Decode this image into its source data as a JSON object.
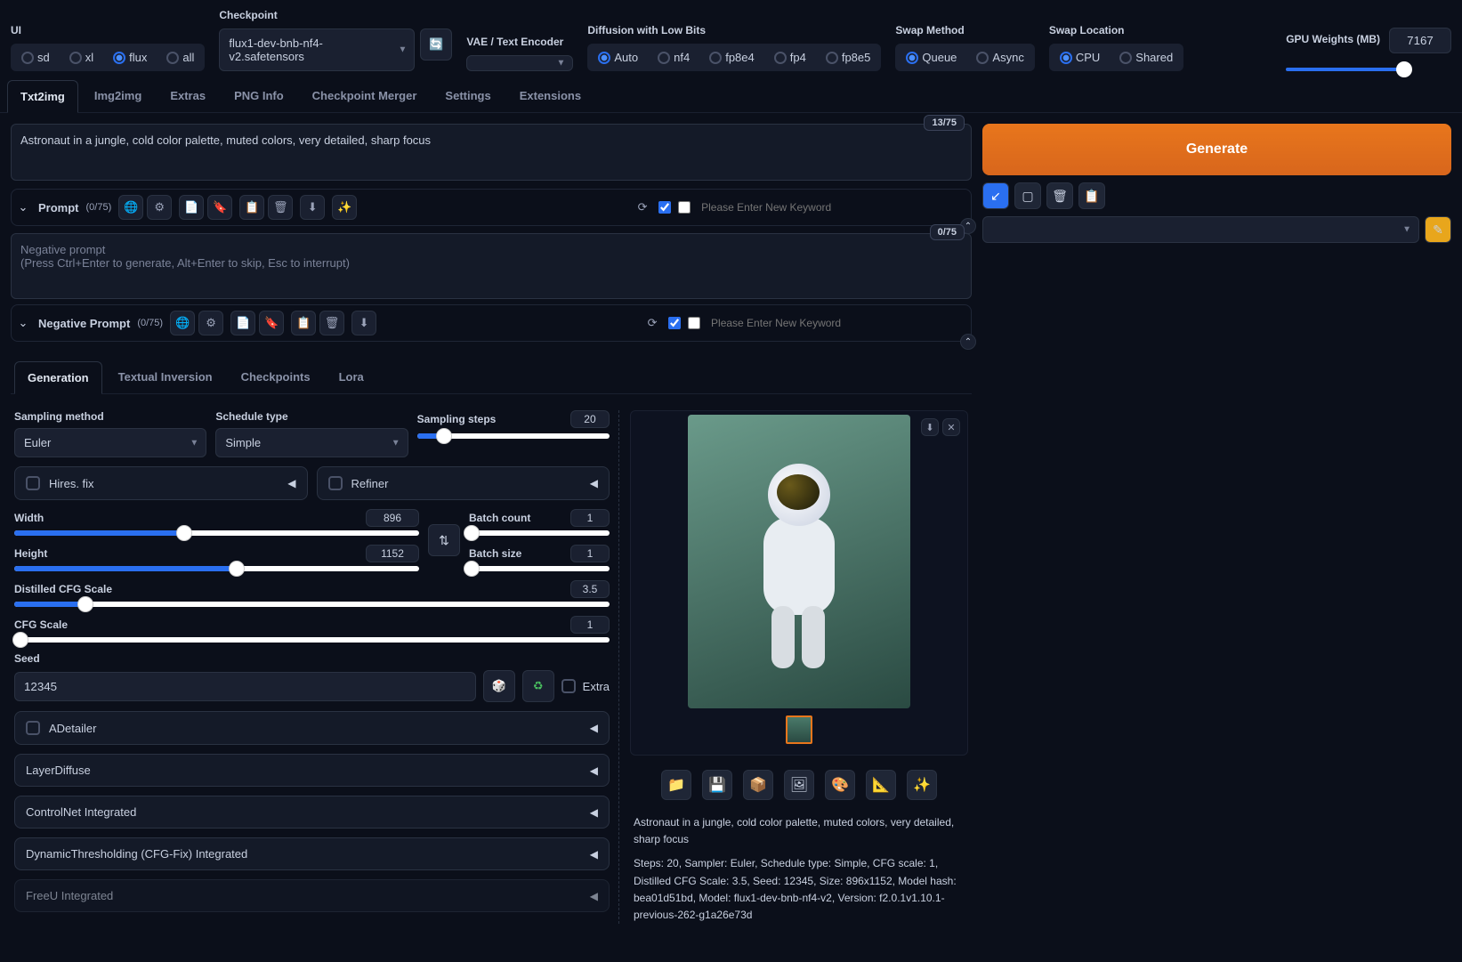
{
  "top": {
    "ui_label": "UI",
    "ui_options": [
      "sd",
      "xl",
      "flux",
      "all"
    ],
    "ui_selected": "flux",
    "checkpoint_label": "Checkpoint",
    "checkpoint_value": "flux1-dev-bnb-nf4-v2.safetensors",
    "vae_label": "VAE / Text Encoder",
    "vae_value": "",
    "diffusion_label": "Diffusion with Low Bits",
    "diffusion_options": [
      "Auto",
      "nf4",
      "fp8e4",
      "fp4",
      "fp8e5"
    ],
    "diffusion_selected": "Auto",
    "swap_method_label": "Swap Method",
    "swap_method_options": [
      "Queue",
      "Async"
    ],
    "swap_method_selected": "Queue",
    "swap_location_label": "Swap Location",
    "swap_location_options": [
      "CPU",
      "Shared"
    ],
    "swap_location_selected": "CPU",
    "gpu_label": "GPU Weights (MB)",
    "gpu_value": "7167"
  },
  "tabs": [
    "Txt2img",
    "Img2img",
    "Extras",
    "PNG Info",
    "Checkpoint Merger",
    "Settings",
    "Extensions"
  ],
  "active_tab": "Txt2img",
  "prompt": {
    "value": "Astronaut in a jungle, cold color palette, muted colors, very detailed, sharp focus",
    "tokens": "13/75",
    "label": "Prompt",
    "sub": "(0/75)",
    "keyword_placeholder": "Please Enter New Keyword"
  },
  "neg": {
    "placeholder_title": "Negative prompt",
    "placeholder_help": "(Press Ctrl+Enter to generate, Alt+Enter to skip, Esc to interrupt)",
    "tokens": "0/75",
    "label": "Negative Prompt",
    "sub": "(0/75)",
    "keyword_placeholder": "Please Enter New Keyword"
  },
  "generate": "Generate",
  "subtabs": [
    "Generation",
    "Textual Inversion",
    "Checkpoints",
    "Lora"
  ],
  "active_subtab": "Generation",
  "gen": {
    "sampling_method_label": "Sampling method",
    "sampling_method": "Euler",
    "schedule_label": "Schedule type",
    "schedule": "Simple",
    "steps_label": "Sampling steps",
    "steps": "20",
    "hires_label": "Hires. fix",
    "refiner_label": "Refiner",
    "width_label": "Width",
    "width": "896",
    "height_label": "Height",
    "height": "1152",
    "batch_count_label": "Batch count",
    "batch_count": "1",
    "batch_size_label": "Batch size",
    "batch_size": "1",
    "dcfg_label": "Distilled CFG Scale",
    "dcfg": "3.5",
    "cfg_label": "CFG Scale",
    "cfg": "1",
    "seed_label": "Seed",
    "seed": "12345",
    "extra_label": "Extra",
    "accordions": [
      "ADetailer",
      "LayerDiffuse",
      "ControlNet Integrated",
      "DynamicThresholding (CFG-Fix) Integrated",
      "FreeU Integrated"
    ]
  },
  "output": {
    "prompt_echo": "Astronaut in a jungle, cold color palette, muted colors, very detailed, sharp focus",
    "meta": "Steps: 20, Sampler: Euler, Schedule type: Simple, CFG scale: 1, Distilled CFG Scale: 3.5, Seed: 12345, Size: 896x1152, Model hash: bea01d51bd, Model: flux1-dev-bnb-nf4-v2, Version: f2.0.1v1.10.1-previous-262-g1a26e73d"
  }
}
